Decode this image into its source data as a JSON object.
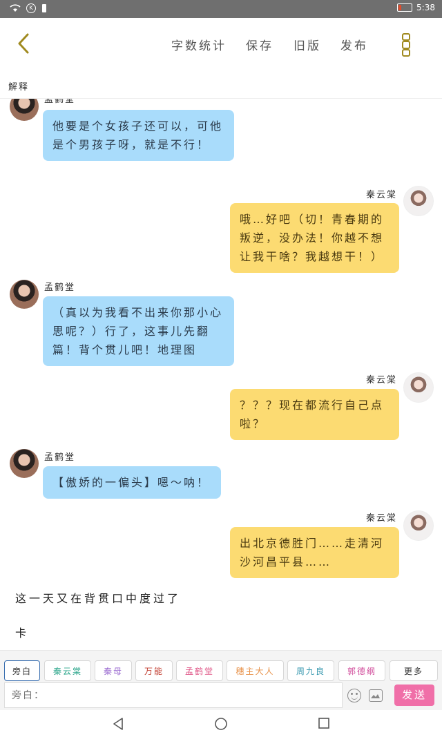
{
  "status": {
    "time": "5:38",
    "battery_fill": 0.2,
    "k_badge": "K"
  },
  "header": {
    "menu": [
      "字数统计",
      "保存",
      "旧版",
      "发布"
    ],
    "explain": "解释"
  },
  "messages": [
    {
      "side": "left",
      "name": "孟鹤堂",
      "text": "他要是个女孩子还可以，可他是个男孩子呀，就是不行！"
    },
    {
      "side": "right",
      "name": "秦云棠",
      "text": "哦…好吧（切！青春期的叛逆，没办法！你越不想让我干啥？我越想干！）"
    },
    {
      "side": "left",
      "name": "孟鹤堂",
      "text": "（真以为我看不出来你那小心思呢？）行了，这事儿先翻篇！背个贯儿吧！地理图"
    },
    {
      "side": "right",
      "name": "秦云棠",
      "text": "？？？现在都流行自己点啦？"
    },
    {
      "side": "left",
      "name": "孟鹤堂",
      "text": "【傲娇的一偏头】嗯～呐！"
    },
    {
      "side": "right",
      "name": "秦云棠",
      "text": "出北京德胜门……走清河沙河昌平县……"
    }
  ],
  "narration": [
    "这一天又在背贯口中度过了",
    "卡"
  ],
  "roles": [
    {
      "label": "旁白",
      "color": "#333333"
    },
    {
      "label": "秦云棠",
      "color": "#2aa58a"
    },
    {
      "label": "秦母",
      "color": "#9a6ad0"
    },
    {
      "label": "万能",
      "color": "#c0392b"
    },
    {
      "label": "孟鹤堂",
      "color": "#e05a8a"
    },
    {
      "label": "穗主大人",
      "color": "#e8924a"
    },
    {
      "label": "周九良",
      "color": "#3a9ab0"
    },
    {
      "label": "郭德纲",
      "color": "#d04a9a"
    },
    {
      "label": "更多",
      "color": "#333333"
    }
  ],
  "input": {
    "placeholder": "旁白："
  },
  "send_label": "发送"
}
